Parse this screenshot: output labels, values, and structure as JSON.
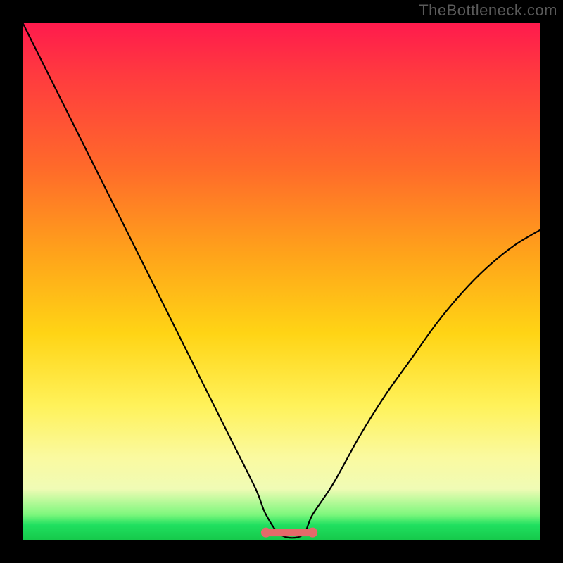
{
  "watermark": "TheBottleneck.com",
  "chart_data": {
    "type": "line",
    "title": "",
    "xlabel": "",
    "ylabel": "",
    "xlim": [
      0,
      100
    ],
    "ylim": [
      0,
      100
    ],
    "grid": false,
    "series": [
      {
        "name": "bottleneck-curve",
        "x": [
          0,
          5,
          10,
          15,
          20,
          25,
          30,
          35,
          40,
          45,
          47,
          50,
          54,
          56,
          60,
          65,
          70,
          75,
          80,
          85,
          90,
          95,
          100
        ],
        "values": [
          100,
          90,
          80,
          70,
          60,
          50,
          40,
          30,
          20,
          10,
          5,
          1,
          1,
          5,
          11,
          20,
          28,
          35,
          42,
          48,
          53,
          57,
          60
        ]
      }
    ],
    "highlight": {
      "name": "optimal-range",
      "x_start": 47,
      "x_end": 56,
      "y": 1
    },
    "background_gradient": {
      "orientation": "vertical",
      "stops": [
        {
          "pos": 0.0,
          "color": "#ff1a4d"
        },
        {
          "pos": 0.28,
          "color": "#ff6a2a"
        },
        {
          "pos": 0.6,
          "color": "#ffd415"
        },
        {
          "pos": 0.84,
          "color": "#fafaa0"
        },
        {
          "pos": 0.97,
          "color": "#20e060"
        },
        {
          "pos": 1.0,
          "color": "#15c84a"
        }
      ]
    }
  }
}
